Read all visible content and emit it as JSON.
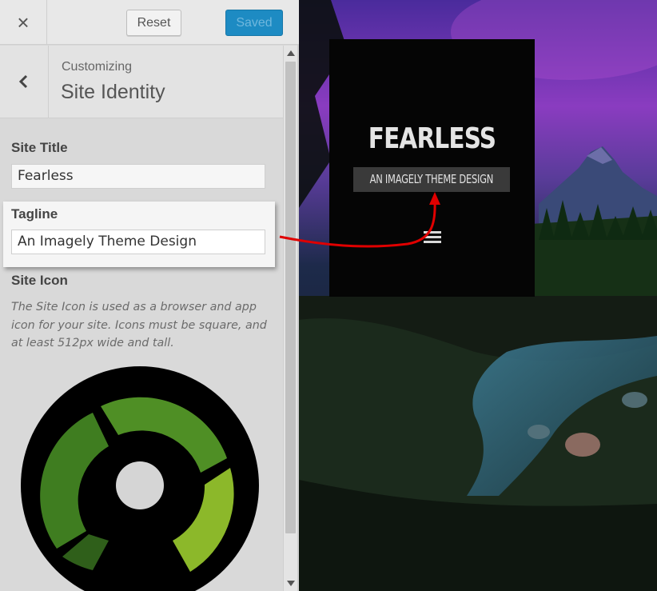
{
  "topbar": {
    "close_icon": "×",
    "reset_label": "Reset",
    "saved_label": "Saved"
  },
  "section": {
    "back_icon": "‹",
    "breadcrumb": "Customizing",
    "title": "Site Identity"
  },
  "fields": {
    "site_title_label": "Site Title",
    "site_title_value": "Fearless",
    "tagline_label": "Tagline",
    "tagline_value": "An Imagely Theme Design",
    "site_icon_label": "Site Icon",
    "site_icon_description": "The Site Icon is used as a browser and app icon for your site. Icons must be square, and at least 512px wide and tall."
  },
  "preview": {
    "site_title": "FEARLESS",
    "tagline": "AN IMAGELY THEME DESIGN"
  },
  "colors": {
    "accent_blue": "#1d8bc3",
    "arrow_red": "#e00000",
    "icon_green_dark": "#2f6b1f",
    "icon_green": "#4f8f25",
    "icon_green_light": "#8cb82a"
  }
}
